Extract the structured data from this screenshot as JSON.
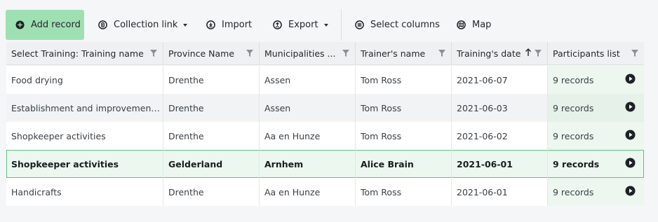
{
  "toolbar": {
    "add_record": "Add record",
    "collection_link": "Collection link",
    "import": "Import",
    "export": "Export",
    "select_columns": "Select columns",
    "map": "Map"
  },
  "columns": [
    {
      "label": "Select Training: Training name"
    },
    {
      "label": "Province Name"
    },
    {
      "label": "Municipalities ..."
    },
    {
      "label": "Trainer's name"
    },
    {
      "label": "Training's date"
    },
    {
      "label": "Participants list"
    }
  ],
  "rows": [
    {
      "training": "Food drying",
      "province": "Drenthe",
      "municipality": "Assen",
      "trainer": "Tom Ross",
      "date": "2021-06-07",
      "participants": "9 records"
    },
    {
      "training": "Establishment and improvement...",
      "province": "Drenthe",
      "municipality": "Assen",
      "trainer": "Tom Ross",
      "date": "2021-06-03",
      "participants": "9 records"
    },
    {
      "training": "Shopkeeper activities",
      "province": "Drenthe",
      "municipality": "Aa en Hunze",
      "trainer": "Tom Ross",
      "date": "2021-06-02",
      "participants": "9 records"
    },
    {
      "training": "Shopkeeper activities",
      "province": "Gelderland",
      "municipality": "Arnhem",
      "trainer": "Alice Brain",
      "date": "2021-06-01",
      "participants": "9 records"
    },
    {
      "training": "Handicrafts",
      "province": "Drenthe",
      "municipality": "Aa en Hunze",
      "trainer": "Tom Ross",
      "date": "2021-06-01",
      "participants": "9 records"
    }
  ],
  "selected_row_index": 3,
  "sort": {
    "column": "Training's date",
    "direction": "ascending"
  },
  "colors": {
    "accent": "#9fe0b3",
    "selected_border": "#5cc37b",
    "selected_bg": "#ecf8ef"
  },
  "icons": [
    "plus-circle-icon",
    "link-icon",
    "import-icon",
    "export-icon",
    "columns-icon",
    "map-icon",
    "filter-icon",
    "sort-up-icon",
    "play-circle-icon",
    "chevron-down-icon"
  ]
}
